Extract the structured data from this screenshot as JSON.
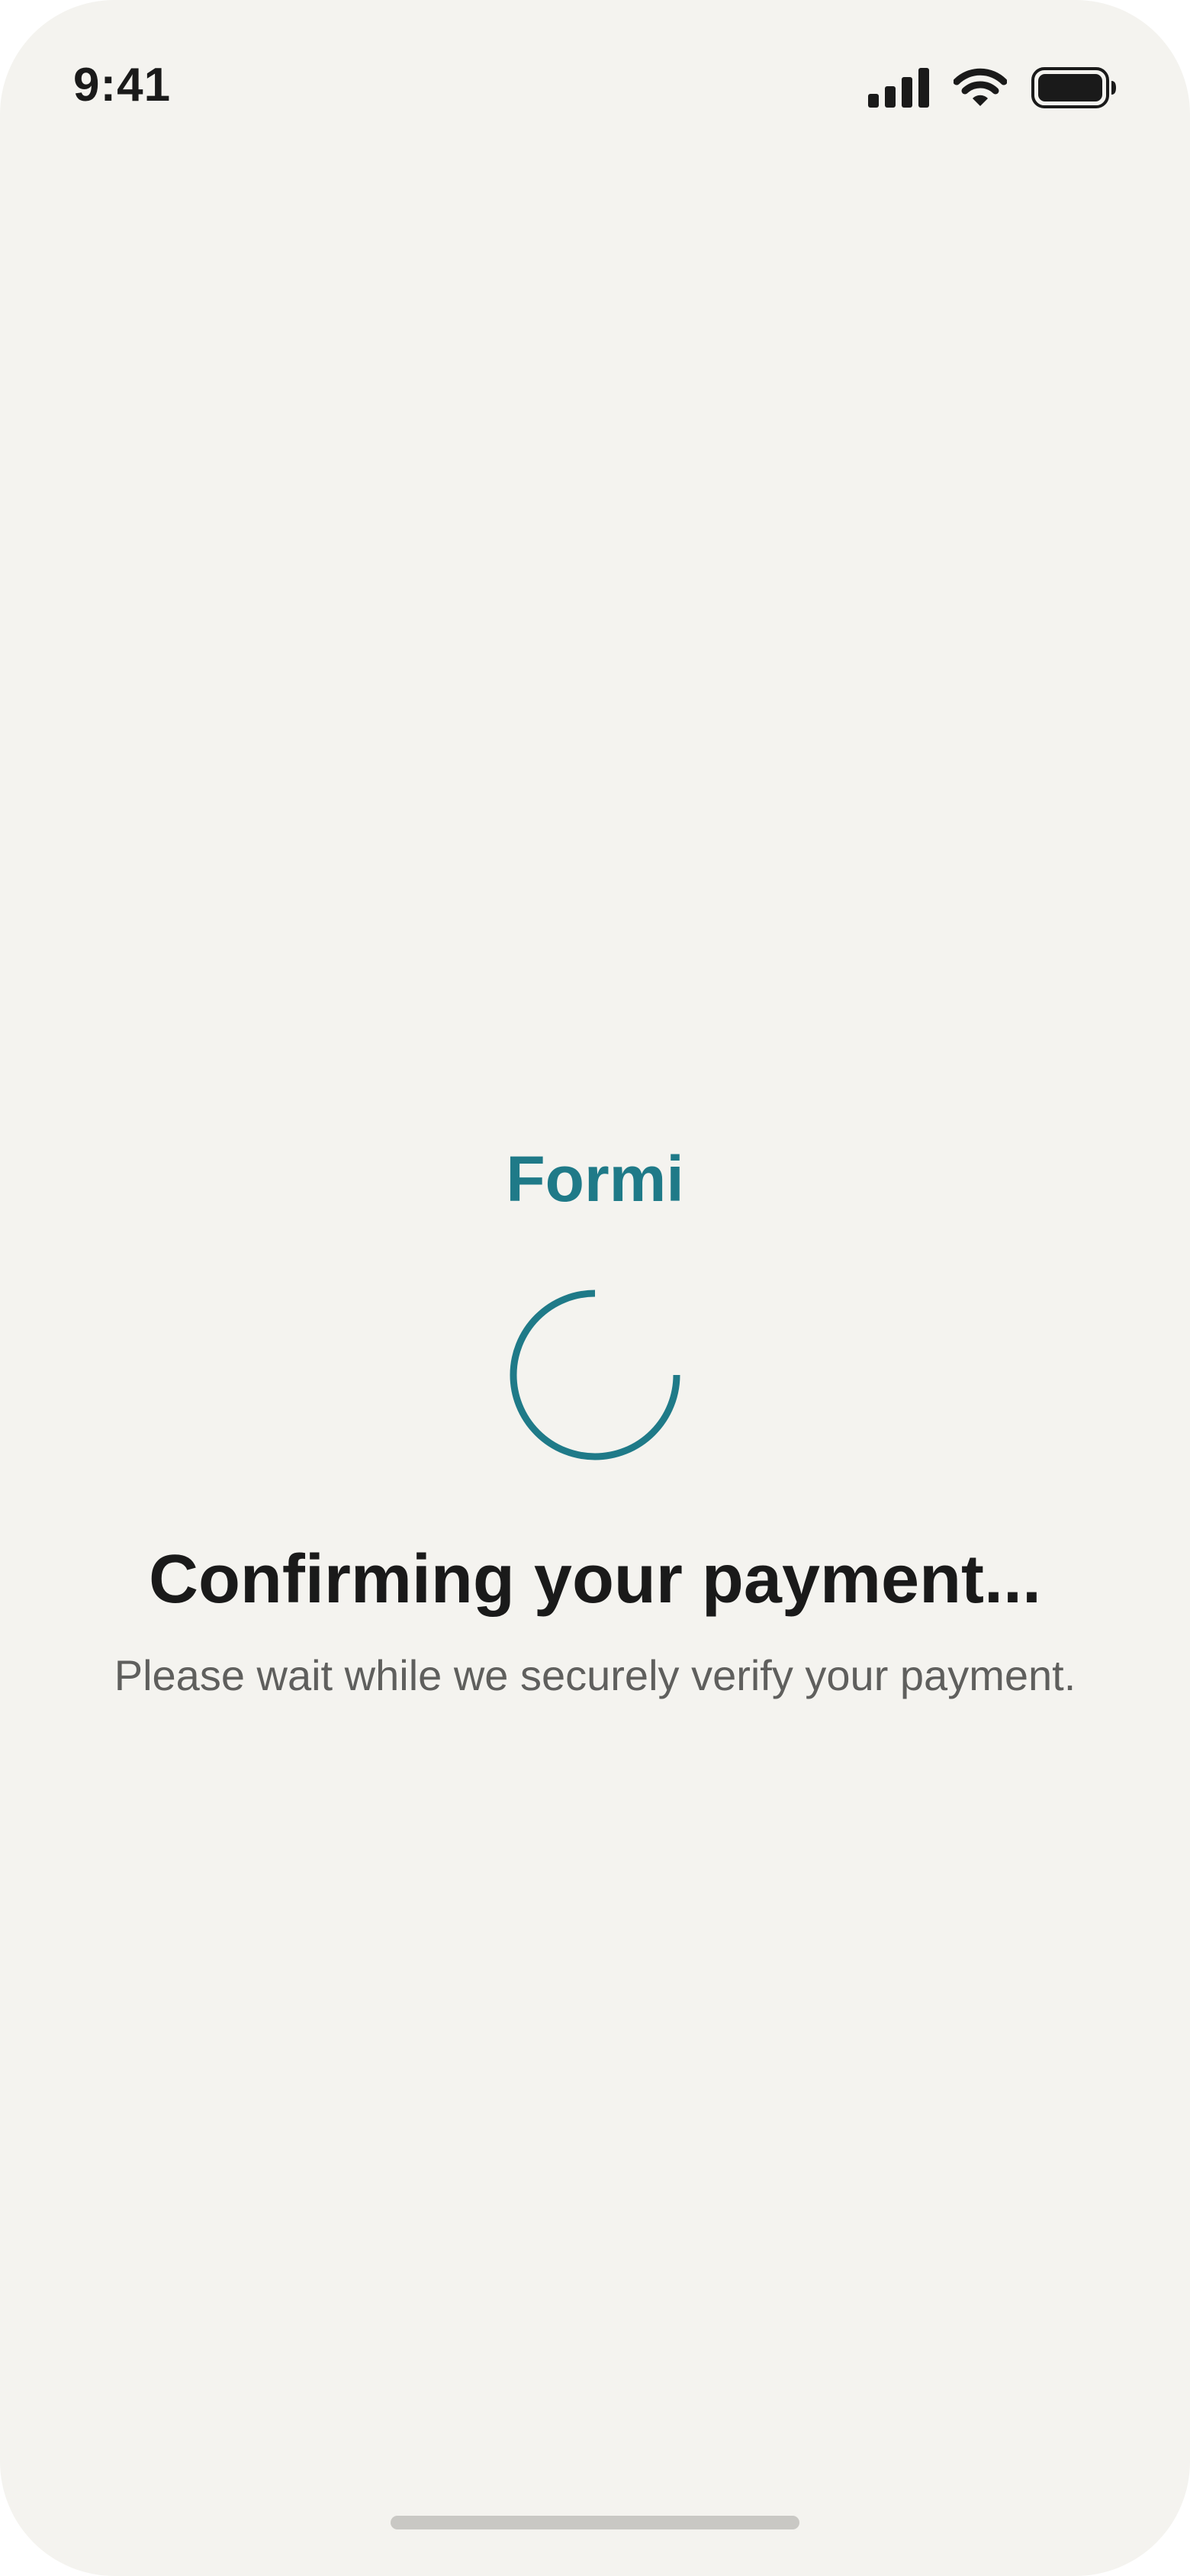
{
  "status_bar": {
    "time": "9:41",
    "icons": [
      "cellular-signal-icon",
      "wifi-icon",
      "battery-icon"
    ]
  },
  "brand": {
    "name": "Formi",
    "color": "#1f7a88"
  },
  "spinner": {
    "icon": "loading-spinner-icon",
    "color": "#1f7a88"
  },
  "message": {
    "headline": "Confirming your payment...",
    "subtext": "Please wait while we securely verify your payment."
  },
  "colors": {
    "background": "#f4f3ef",
    "text_primary": "#1a1a1a",
    "text_secondary": "#5f5f5d",
    "accent": "#1f7a88"
  }
}
